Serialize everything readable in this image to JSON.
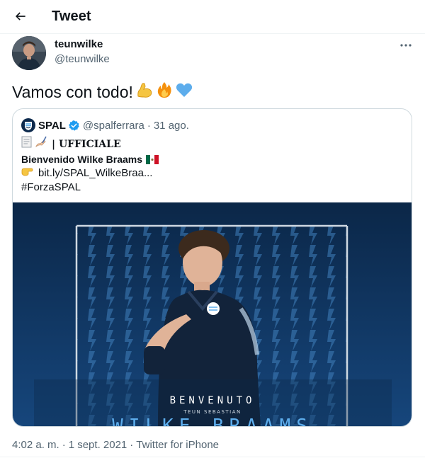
{
  "header": {
    "title": "Tweet"
  },
  "tweet": {
    "display_name": "teunwilke",
    "handle": "@teunwilke",
    "text": "Vamos con todo!",
    "emojis": [
      "flexed-biceps-icon",
      "fire-icon",
      "blue-heart-icon"
    ]
  },
  "quoted": {
    "name": "SPAL",
    "handle": "@spalferrara",
    "separator": "·",
    "date": "31 ago.",
    "line1": "| UFFICIALE",
    "line2": "Bienvenido Wilke Braams",
    "line3": "bit.ly/SPAL_WilkeBraa...",
    "line4": "#ForzaSPAL",
    "media": {
      "title": "BENVENUTO",
      "subtitle": "TEUN SEBASTIAN",
      "name": "WILKE BRAAMS"
    }
  },
  "footer": {
    "time": "4:02 a. m.",
    "sep": "·",
    "date": "1 sept. 2021",
    "source": "Twitter for iPhone"
  },
  "colors": {
    "accent": "#1d9bf0",
    "muted": "#536471",
    "card_border": "#cfd9de",
    "media_bg": "#0d2a4d"
  }
}
